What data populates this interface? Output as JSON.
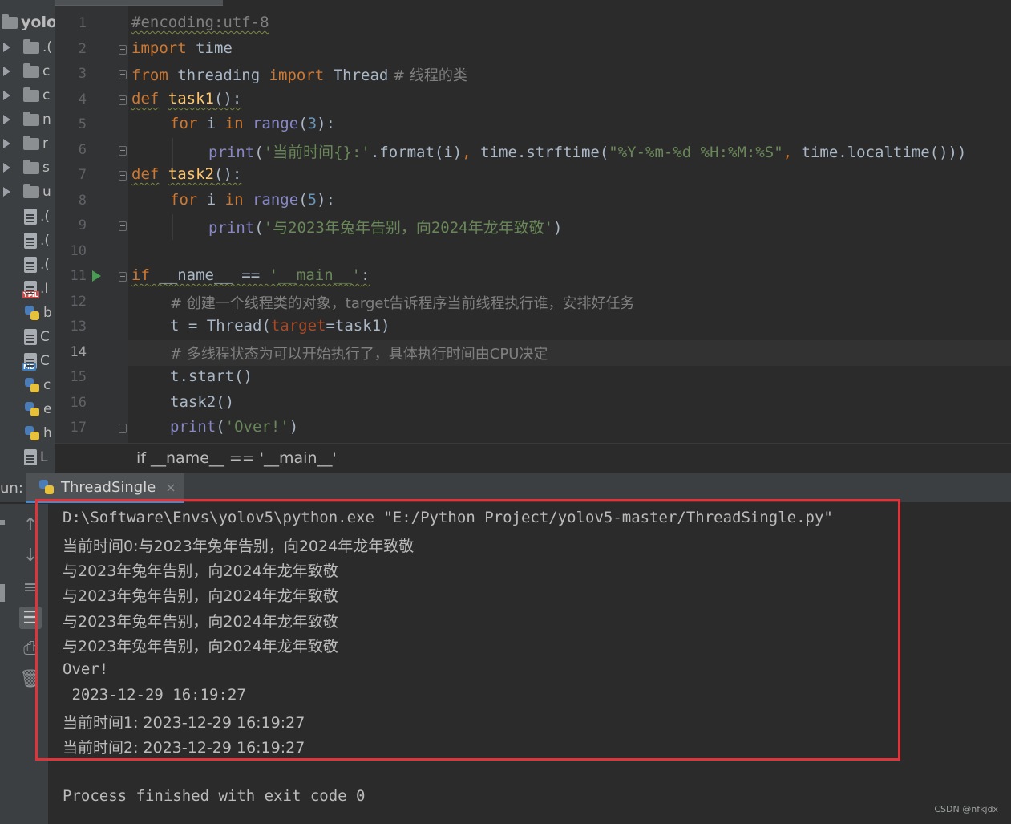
{
  "project": {
    "root_label": "yolo",
    "tree_rows": [
      {
        "kind": "folder",
        "label": ".("
      },
      {
        "kind": "folder",
        "label": "c"
      },
      {
        "kind": "folder",
        "label": "c"
      },
      {
        "kind": "folder-special",
        "label": "n"
      },
      {
        "kind": "folder",
        "label": "r"
      },
      {
        "kind": "folder",
        "label": "s"
      },
      {
        "kind": "folder-special",
        "label": "u"
      }
    ],
    "file_rows": [
      {
        "kind": "file",
        "label": ".("
      },
      {
        "kind": "file",
        "label": ".("
      },
      {
        "kind": "file-blocked",
        "label": ".("
      },
      {
        "kind": "yml",
        "label": ".I"
      },
      {
        "kind": "py",
        "label": "b"
      },
      {
        "kind": "file",
        "label": "C"
      },
      {
        "kind": "md",
        "label": "C"
      },
      {
        "kind": "py",
        "label": "c"
      },
      {
        "kind": "py",
        "label": "e"
      },
      {
        "kind": "py",
        "label": "h"
      },
      {
        "kind": "file",
        "label": "L"
      }
    ],
    "tags": {
      "yml": "YML",
      "md": "MD"
    }
  },
  "editor": {
    "line_numbers": [
      "1",
      "2",
      "3",
      "4",
      "5",
      "6",
      "7",
      "8",
      "9",
      "10",
      "11",
      "12",
      "13",
      "14",
      "15",
      "16",
      "17"
    ],
    "lines": {
      "l1": "#encoding:utf-8",
      "l2_kw": "import",
      "l2_rest": " time",
      "l3_kw1": "from",
      "l3_mid": " threading ",
      "l3_kw2": "import",
      "l3_rest": " Thread",
      "l3_cmt": " # 线程的类",
      "l4_kw": "def",
      "l4_fn": "task1",
      "l4_rest": "():",
      "l5_kw": "for",
      "l5_mid": " i ",
      "l5_kw2": "in",
      "l5_bi": " range",
      "l5_p1": "(",
      "l5_num": "3",
      "l5_p2": "):",
      "l6_bi": "print",
      "l6_p1": "(",
      "l6_str": "'当前时间{}:'",
      "l6_mid": ".format(i)",
      "l6_comma": ",",
      "l6_mid2": " time.strftime(",
      "l6_str2": "\"%Y-%m-%d %H:%M:%S\"",
      "l6_comma2": ",",
      "l6_rest": " time.localtime()))",
      "l7_kw": "def",
      "l7_fn": "task2",
      "l7_rest": "():",
      "l8_kw": "for",
      "l8_mid": " i ",
      "l8_kw2": "in",
      "l8_bi": " range",
      "l8_p1": "(",
      "l8_num": "5",
      "l8_p2": "):",
      "l9_bi": "print",
      "l9_p1": "(",
      "l9_str": "'与2023年兔年告别，向2024年龙年致敬'",
      "l9_p2": ")",
      "l11_kw": "if",
      "l11_mid": " __name__ == ",
      "l11_str": "'__main__'",
      "l11_rest": ":",
      "l12": "# 创建一个线程类的对象，target告诉程序当前线程执行谁，安排好任务",
      "l13_a": "t = Thread(",
      "l13_kwarg": "target",
      "l13_b": "=task1)",
      "l14": "# 多线程状态为可以开始执行了，具体执行时间由CPU决定",
      "l15": "t.start()",
      "l16": "task2()",
      "l17_bi": "print",
      "l17_p1": "(",
      "l17_str": "'Over!'",
      "l17_p2": ")"
    },
    "current_line": 14
  },
  "breadcrumb": "if __name__ == '__main__'",
  "run": {
    "label": "un:",
    "tab_label": "ThreadSingle",
    "tab_close": "×",
    "output": [
      "D:\\Software\\Envs\\yolov5\\python.exe \"E:/Python Project/yolov5-master/ThreadSingle.py\"",
      "当前时间0:与2023年兔年告别，向2024年龙年致敬",
      "与2023年兔年告别，向2024年龙年致敬",
      "与2023年兔年告别，向2024年龙年致敬",
      "与2023年兔年告别，向2024年龙年致敬",
      "与2023年兔年告别，向2024年龙年致敬",
      "Over!",
      " 2023-12-29 16:19:27",
      "当前时间1: 2023-12-29 16:19:27",
      "当前时间2: 2023-12-29 16:19:27",
      "",
      "Process finished with exit code 0"
    ],
    "toolbar_icons": [
      "rerun-up-icon",
      "scroll-down-icon",
      "soft-wrap-icon",
      "scroll-to-end-icon",
      "print-icon",
      "trash-icon"
    ],
    "highlight_color": "#e0343b"
  },
  "watermark": "CSDN @nfkjdx",
  "colors": {
    "keyword": "#cc7832",
    "function": "#ffc66d",
    "builtin": "#8888c6",
    "string": "#6a8759",
    "number": "#6897bb",
    "comment": "#808080",
    "kwarg": "#aa4926"
  }
}
